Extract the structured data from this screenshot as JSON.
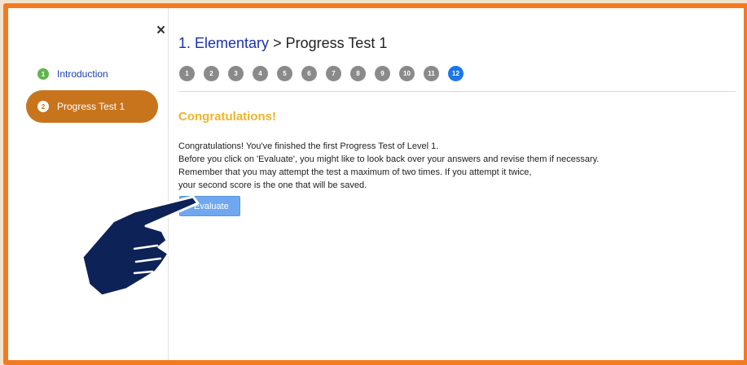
{
  "sidebar": {
    "close_label": "×",
    "items": [
      {
        "number": "1",
        "label": "Introduction"
      },
      {
        "number": "2",
        "label": "Progress Test 1"
      }
    ]
  },
  "header": {
    "breadcrumb_link": "1. Elementary",
    "separator": ">",
    "title": "Progress Test 1"
  },
  "steps": [
    "1",
    "2",
    "3",
    "4",
    "5",
    "6",
    "7",
    "8",
    "9",
    "10",
    "11",
    "12"
  ],
  "current_step": "12",
  "content": {
    "heading": "Congratulations!",
    "lines": [
      "Congratulations! You've finished the first Progress Test of Level 1.",
      "Before you click on 'Evaluate', you might like to look back over your answers and revise them if necessary.",
      "Remember that you may attempt the test a maximum of two times. If you attempt it twice,",
      "your second score is the one that will be saved."
    ],
    "evaluate_label": "Evaluate"
  },
  "colors": {
    "frame_border": "#f47a20",
    "active_item": "#c8741d",
    "heading": "#f0b429",
    "current_step": "#1c77e8",
    "button": "#6fa8f0"
  }
}
